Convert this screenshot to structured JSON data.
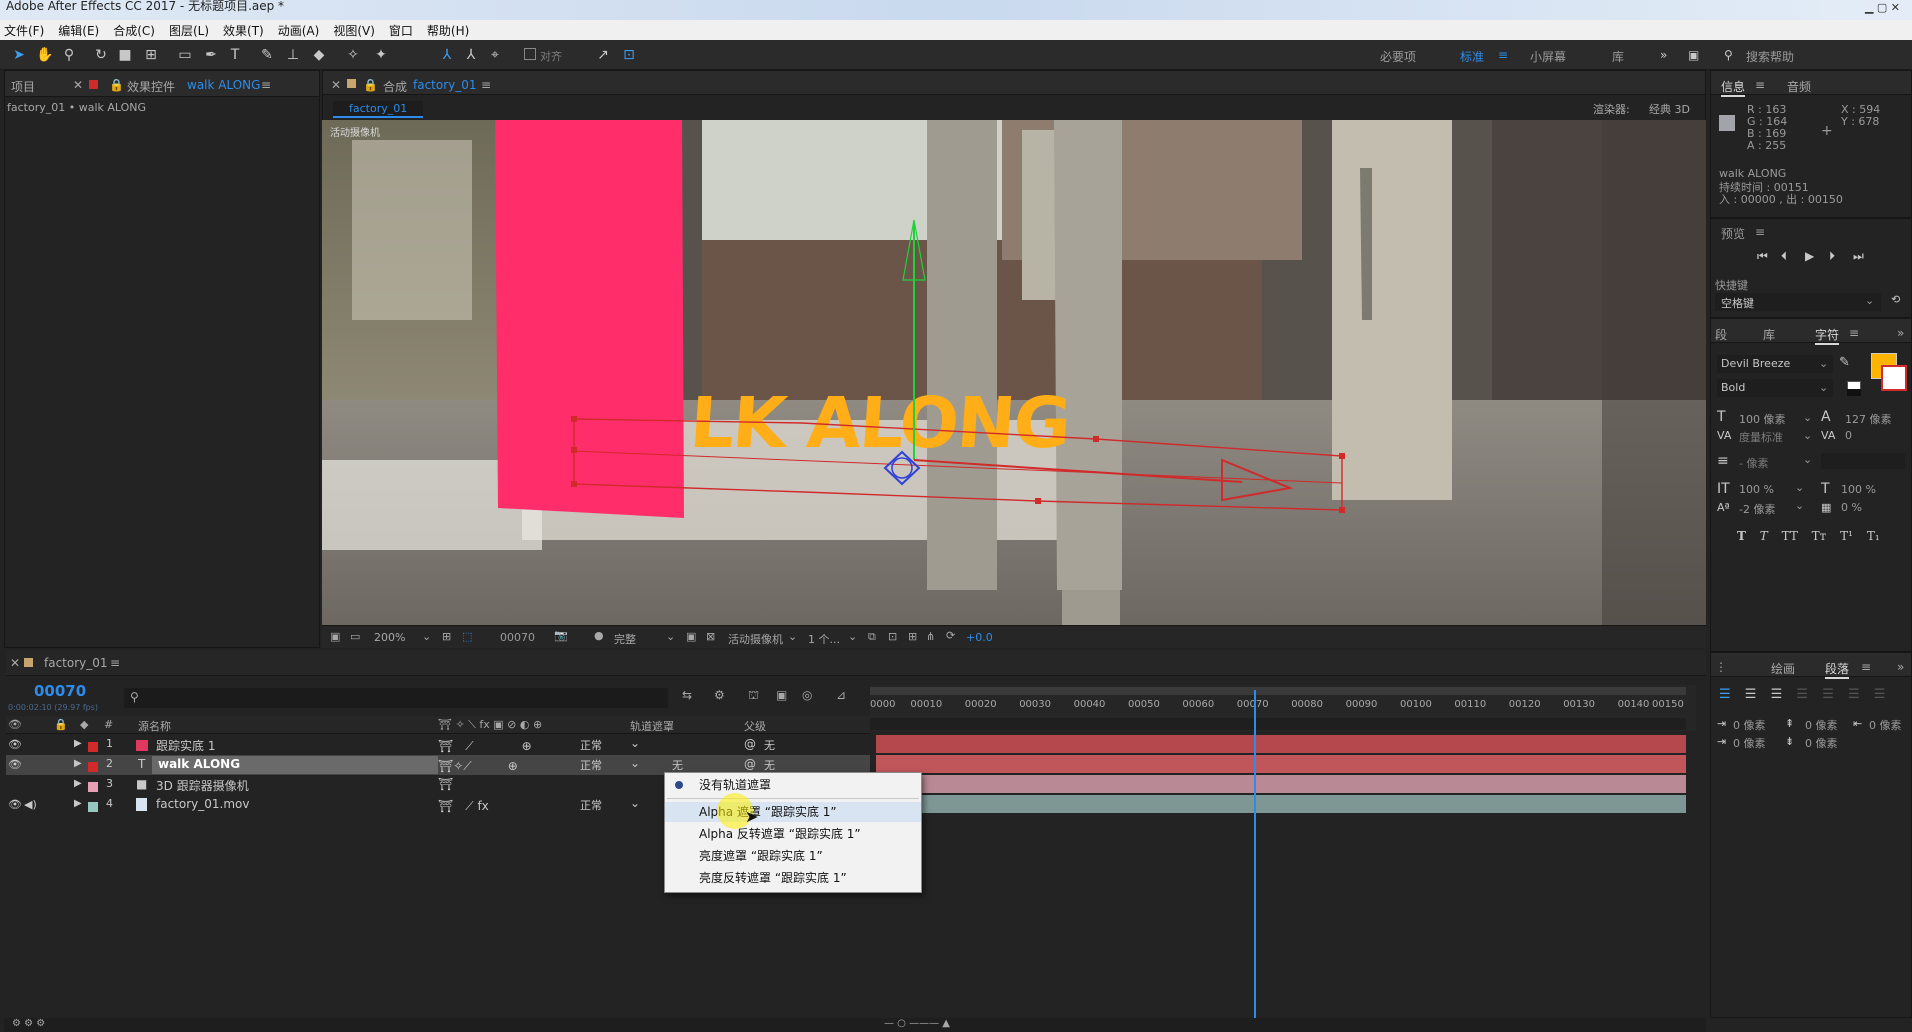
{
  "window": {
    "title": "Adobe After Effects CC 2017 - 无标题项目.aep *"
  },
  "menu": [
    "文件(F)",
    "编辑(E)",
    "合成(C)",
    "图层(L)",
    "效果(T)",
    "动画(A)",
    "视图(V)",
    "窗口",
    "帮助(H)"
  ],
  "toolbar": {
    "tools": [
      "selection-tool-icon",
      "hand-tool-icon",
      "zoom-tool-icon",
      "rotate-tool-icon",
      "camera-tool-icon",
      "pan-behind-icon",
      "rectangle-tool-icon",
      "pen-tool-icon",
      "type-tool-icon",
      "brush-tool-icon",
      "clone-stamp-icon",
      "eraser-icon",
      "roto-brush-icon",
      "puppet-pin-icon"
    ],
    "align_label": "对齐",
    "workspaces": [
      "必要项",
      "标准",
      "小屏幕",
      "库"
    ],
    "active_workspace": "标准",
    "search_placeholder": "搜索帮助"
  },
  "project_panel": {
    "tab_project": "项目",
    "tab_effects": "效果控件",
    "effects_layer": "walk ALONG",
    "breadcrumb": "factory_01 • walk ALONG"
  },
  "comp_panel": {
    "tab_label": "合成",
    "comp_name": "factory_01",
    "subtab": "factory_01",
    "renderer_label": "渲染器:",
    "renderer_value": "经典 3D",
    "camera_label": "活动摄像机",
    "overlay_text": "LK ALONG"
  },
  "viewer_bar": {
    "zoom": "200%",
    "timecode": "00070",
    "resolution": "完整",
    "camera": "活动摄像机",
    "views": "1 个...",
    "exposure": "+0.0"
  },
  "timeline": {
    "tab": "factory_01",
    "current_time": "00070",
    "sub_time": "0:00:02:10 (29.97 fps)",
    "col_source": "源名称",
    "col_track_matte": "轨道遮罩",
    "col_parent": "父级",
    "ruler_ticks": [
      "0000",
      "00010",
      "00020",
      "00030",
      "00040",
      "00050",
      "00060",
      "00070",
      "00080",
      "00090",
      "00100",
      "00110",
      "00120",
      "00130",
      "00140",
      "00150"
    ],
    "playhead_frame": 70,
    "total_frames": 150,
    "layers": [
      {
        "num": "1",
        "name": "跟踪实底 1",
        "type": "solid",
        "color": "#e0385e",
        "mode": "正常",
        "matte": "",
        "parent": "无",
        "bar_color": "#b4484c"
      },
      {
        "num": "2",
        "name": "walk ALONG",
        "type": "text",
        "color": "#e0385e",
        "mode": "正常",
        "matte": "无",
        "parent": "无",
        "bar_color": "#b4484c"
      },
      {
        "num": "3",
        "name": "3D 跟踪器摄像机",
        "type": "camera",
        "color": "#e6a0b4",
        "mode": "",
        "matte": "",
        "parent": "",
        "bar_color": "#b98996"
      },
      {
        "num": "4",
        "name": "factory_01.mov",
        "type": "footage",
        "color": "#96c8c0",
        "mode": "正常",
        "matte": "",
        "parent": "",
        "bar_color": "#7e9795"
      }
    ]
  },
  "matte_menu": {
    "items": [
      "没有轨道遮罩",
      "Alpha 遮罩 “跟踪实底 1”",
      "Alpha 反转遮罩 “跟踪实底 1”",
      "亮度遮罩 “跟踪实底 1”",
      "亮度反转遮罩 “跟踪实底 1”"
    ],
    "checked_index": 0,
    "hover_index": 1
  },
  "info_panel": {
    "tab_info": "信息",
    "tab_audio": "音频",
    "r": "R : 163",
    "g": "G : 164",
    "b": "B : 169",
    "a": "A : 255",
    "x": "X : 594",
    "y": "Y : 678",
    "layer_name": "walk ALONG",
    "duration": "持续时间 : 00151",
    "in_out": "入 : 00000 , 出 : 00150"
  },
  "preview_panel": {
    "tab": "预览",
    "shortcut_label": "快捷键",
    "shortcut_value": "空格键"
  },
  "character_panel": {
    "tab_para": "段",
    "tab_lib": "库",
    "tab_char": "字符",
    "font": "Devil Breeze",
    "style": "Bold",
    "size": "100 像素",
    "leading": "127 像素",
    "kerning": "度量标准",
    "tracking": "0",
    "stroke": "- 像素",
    "vscale": "100 %",
    "hscale": "100 %",
    "baseline": "-2 像素",
    "tsume": "0 %",
    "fill_color": "#ffb400",
    "style_buttons": [
      "T",
      "T",
      "TT",
      "Tт",
      "T¹",
      "T₁"
    ]
  },
  "paragraph_panel": {
    "tab_paint": "绘画",
    "tab_para": "段落",
    "indent_left": "0 像素",
    "indent_right": "0 像素",
    "indent_first": "0 像素",
    "space_before": "0 像素",
    "space_after": "0 像素"
  }
}
